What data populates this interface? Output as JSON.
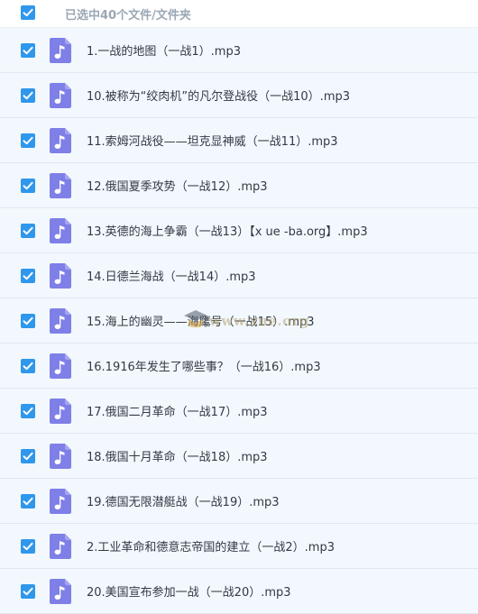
{
  "header": {
    "selection_text": "已选中40个文件/文件夹",
    "checked": true
  },
  "colors": {
    "checkbox": "#2f97ec",
    "file_icon": "#7f7fe8",
    "row_background": "#f2f8fd",
    "header_text": "#9aa7b4"
  },
  "icons": {
    "checkbox": "checkmark-icon",
    "file": "music-note-icon"
  },
  "files": [
    {
      "name": "1.一战的地图（一战1）.mp3",
      "checked": true
    },
    {
      "name": "10.被称为“绞肉机”的凡尔登战役（一战10）.mp3",
      "checked": true
    },
    {
      "name": "11.索姆河战役——坦克显神威（一战11）.mp3",
      "checked": true
    },
    {
      "name": "12.俄国夏季攻势（一战12）.mp3",
      "checked": true
    },
    {
      "name": "13.英德的海上争霸（一战13）【x ue -ba.org】.mp3",
      "checked": true
    },
    {
      "name": "14.日德兰海战（一战14）.mp3",
      "checked": true
    },
    {
      "name": "15.海上的幽灵——海鹰号（一战15）.mp3",
      "checked": true
    },
    {
      "name": "16.1916年发生了哪些事？（一战16）.mp3",
      "checked": true
    },
    {
      "name": "17.俄国二月革命（一战17）.mp3",
      "checked": true
    },
    {
      "name": "18.俄国十月革命（一战18）.mp3",
      "checked": true
    },
    {
      "name": "19.德国无限潜艇战（一战19）.mp3",
      "checked": true
    },
    {
      "name": "2.工业革命和德意志帝国的建立（一战2）.mp3",
      "checked": true
    },
    {
      "name": "20.美国宣布参加一战（一战20）.mp3",
      "checked": true
    }
  ],
  "watermark": {
    "text": "www.xue.org"
  }
}
